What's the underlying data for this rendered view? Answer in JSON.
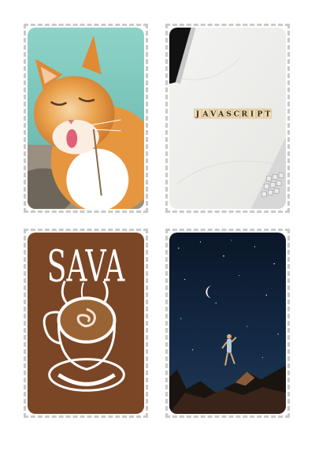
{
  "gallery": {
    "cards": [
      {
        "name": "cat-photo",
        "accent": "#e89a3c"
      },
      {
        "name": "javascript-tiles-photo",
        "tiles": [
          "J",
          "A",
          "V",
          "A",
          "S",
          "C",
          "R",
          "I",
          "P",
          "T"
        ],
        "accent": "#eeeeec"
      },
      {
        "name": "coffee-logo",
        "logo_text": "SAVA",
        "accent": "#7a4626"
      },
      {
        "name": "night-sky-photo",
        "accent": "#0f1f33"
      }
    ]
  }
}
